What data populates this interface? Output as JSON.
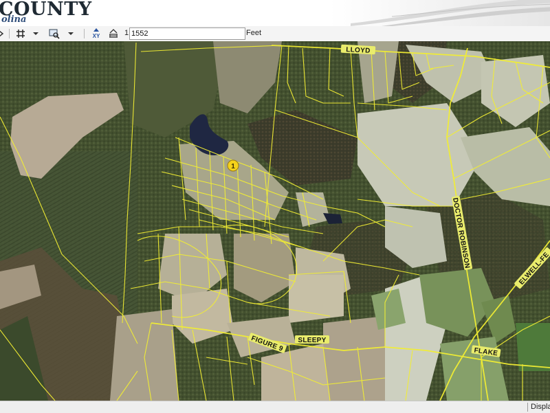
{
  "header": {
    "logo_text": "COUNTY",
    "logo_subtext": "olina"
  },
  "toolbar": {
    "scale_prefix": "1:",
    "scale_value": "1552",
    "units_label": "Feet",
    "xy_label": "XY",
    "icons": [
      "pan-icon",
      "grid-icon",
      "dropdown-arrow-icon",
      "zoom-select-icon",
      "dropdown-arrow-icon",
      "goto-xy-icon",
      "print-map-icon"
    ]
  },
  "map": {
    "base_layer": "aerial imagery",
    "parcel_line_color": "#f2ee33",
    "marker_label": "1",
    "marker_color": "#f5d21a",
    "road_labels": [
      "LLOYD",
      "DOCTOR ROBINSON",
      "ELWELL-FE",
      "FIGURE 9",
      "SLEEPY",
      "FLAKE"
    ]
  },
  "statusbar": {
    "text": "Displa"
  }
}
